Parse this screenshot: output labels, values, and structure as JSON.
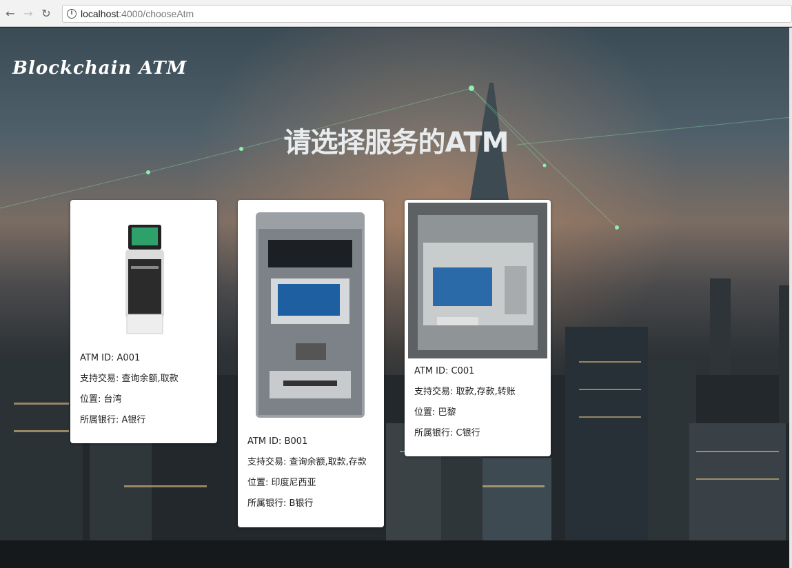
{
  "browser": {
    "url_host": "localhost",
    "url_rest": ":4000/chooseAtm"
  },
  "page": {
    "brand": "Blockchain ATM",
    "heading": "请选择服务的ATM"
  },
  "atms": [
    {
      "id_line": "ATM ID: A001",
      "tx_line": "支持交易: 查询余额,取款",
      "loc_line": "位置: 台湾",
      "bank_line": "所属银行: A银行"
    },
    {
      "id_line": "ATM ID: B001",
      "tx_line": "支持交易: 查询余额,取款,存款",
      "loc_line": "位置: 印度尼西亚",
      "bank_line": "所属银行: B银行"
    },
    {
      "id_line": "ATM ID: C001",
      "tx_line": "支持交易: 取款,存款,转账",
      "loc_line": "位置: 巴黎",
      "bank_line": "所属银行: C银行"
    }
  ]
}
